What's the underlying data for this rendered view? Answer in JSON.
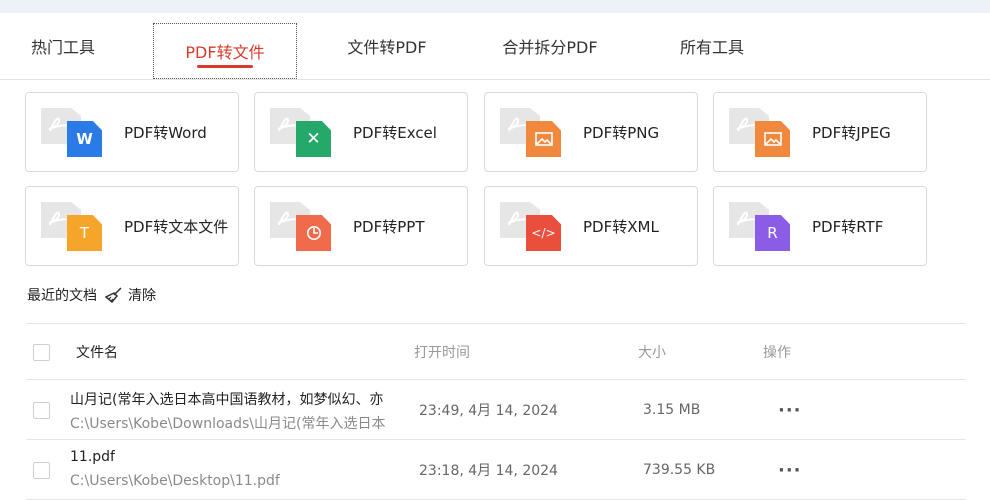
{
  "tabs": [
    {
      "label": "热门工具",
      "active": false
    },
    {
      "label": "PDF转文件",
      "active": true
    },
    {
      "label": "文件转PDF",
      "active": false
    },
    {
      "label": "合并拆分PDF",
      "active": false
    },
    {
      "label": "所有工具",
      "active": false
    }
  ],
  "colors": {
    "accent": "#d93a2b",
    "word": "#2b7be6",
    "excel": "#25a96a",
    "png": "#f0883e",
    "jpeg": "#f0883e",
    "text": "#f4a52a",
    "ppt": "#f06a4c",
    "xml": "#ea4f3d",
    "rtf": "#8b5ce6"
  },
  "tools": [
    {
      "label": "PDF转Word",
      "icon": "word-icon",
      "glyph": "W"
    },
    {
      "label": "PDF转Excel",
      "icon": "excel-icon",
      "glyph": "✕"
    },
    {
      "label": "PDF转PNG",
      "icon": "png-image-icon",
      "glyph": ""
    },
    {
      "label": "PDF转JPEG",
      "icon": "jpeg-image-icon",
      "glyph": ""
    },
    {
      "label": "PDF转文本文件",
      "icon": "text-icon",
      "glyph": "T"
    },
    {
      "label": "PDF转PPT",
      "icon": "ppt-icon",
      "glyph": ""
    },
    {
      "label": "PDF转XML",
      "icon": "xml-icon",
      "glyph": "</>"
    },
    {
      "label": "PDF转RTF",
      "icon": "rtf-icon",
      "glyph": "R"
    }
  ],
  "recent": {
    "title": "最近的文档",
    "clear_label": "清除",
    "clear_icon": "broom-icon"
  },
  "table": {
    "headers": {
      "name": "文件名",
      "time": "打开时间",
      "size": "大小",
      "action": "操作"
    },
    "rows": [
      {
        "name": "山月记(常年入选日本高中国语教材，如梦似幻、亦",
        "path": "C:\\Users\\Kobe\\Downloads\\山月记(常年入选日本",
        "time": "23:49, 4月 14, 2024",
        "size": "3.15 MB",
        "more": "···"
      },
      {
        "name": "11.pdf",
        "path": "C:\\Users\\Kobe\\Desktop\\11.pdf",
        "time": "23:18, 4月 14, 2024",
        "size": "739.55 KB",
        "more": "···"
      }
    ]
  }
}
